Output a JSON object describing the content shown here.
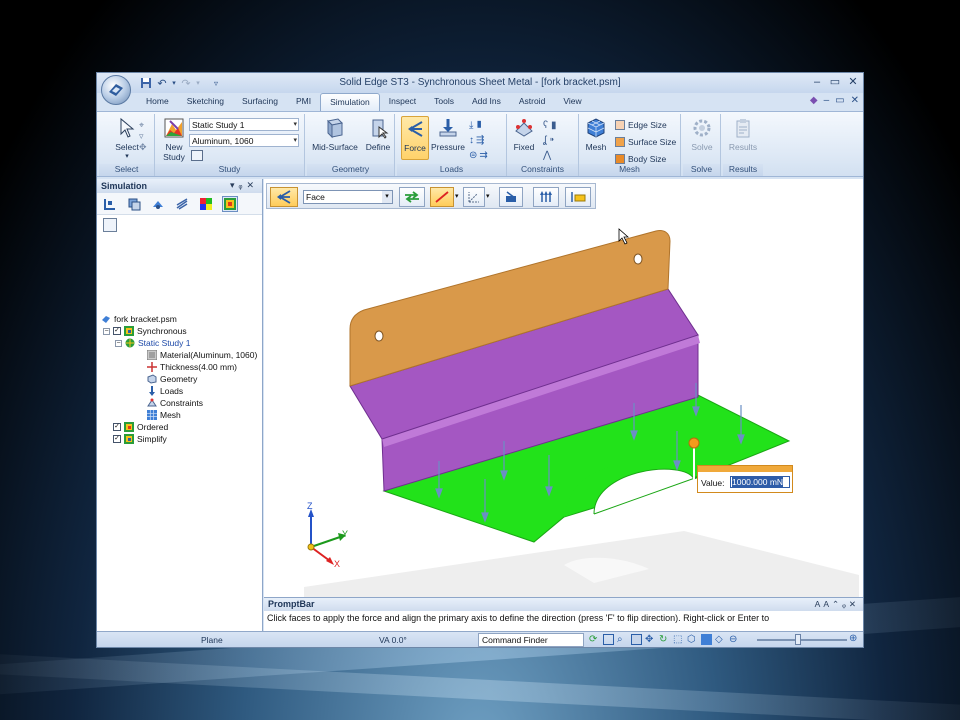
{
  "window": {
    "title": "Solid Edge ST3 - Synchronous Sheet Metal - [fork bracket.psm]"
  },
  "ribbon_tabs": [
    "Home",
    "Sketching",
    "Surfacing",
    "PMI",
    "Simulation",
    "Inspect",
    "Tools",
    "Add Ins",
    "Astroid",
    "View"
  ],
  "active_tab": "Simulation",
  "ribbon": {
    "select": {
      "button": "Select",
      "group": "Select"
    },
    "study": {
      "new_study_line1": "New",
      "new_study_line2": "Study",
      "study_combo": "Static Study 1",
      "material_combo": "Aluminum, 1060",
      "group": "Study"
    },
    "geometry": {
      "mid_surface": "Mid-Surface",
      "define": "Define",
      "group": "Geometry"
    },
    "loads": {
      "force": "Force",
      "pressure": "Pressure",
      "group": "Loads"
    },
    "constraints": {
      "fixed": "Fixed",
      "group": "Constraints"
    },
    "mesh": {
      "mesh": "Mesh",
      "edge_size": "Edge Size",
      "surface_size": "Surface Size",
      "body_size": "Body Size",
      "group": "Mesh"
    },
    "solve": {
      "solve": "Solve",
      "group": "Solve"
    },
    "results": {
      "results": "Results",
      "group": "Results"
    }
  },
  "simulation_pane": {
    "title": "Simulation",
    "tree": {
      "root": "fork bracket.psm",
      "synchronous": "Synchronous",
      "study": "Static Study 1",
      "material": "Material(Aluminum, 1060)",
      "thickness": "Thickness(4.00 mm)",
      "geometry": "Geometry",
      "loads": "Loads",
      "constraints": "Constraints",
      "mesh": "Mesh",
      "ordered": "Ordered",
      "simplify": "Simplify"
    }
  },
  "command_bar": {
    "select_type": "Face"
  },
  "value_box": {
    "label": "Value:",
    "value": "1000.000 mN"
  },
  "axes": {
    "x": "X",
    "y": "Y",
    "z": "Z"
  },
  "promptbar": {
    "title": "PromptBar",
    "text": "Click faces to apply the force and align the primary axis to define the direction (press 'F' to flip direction).  Right-click or Enter to"
  },
  "statusbar": {
    "plane": "Plane",
    "va": "VA 0.0°",
    "command_finder": "Command Finder"
  },
  "colors": {
    "top_flange": "#d9994a",
    "web": "#a457c2",
    "base": "#22e21a",
    "accent_highlight": "#ffcc5a",
    "force_arrow": "#6b8fc4"
  }
}
